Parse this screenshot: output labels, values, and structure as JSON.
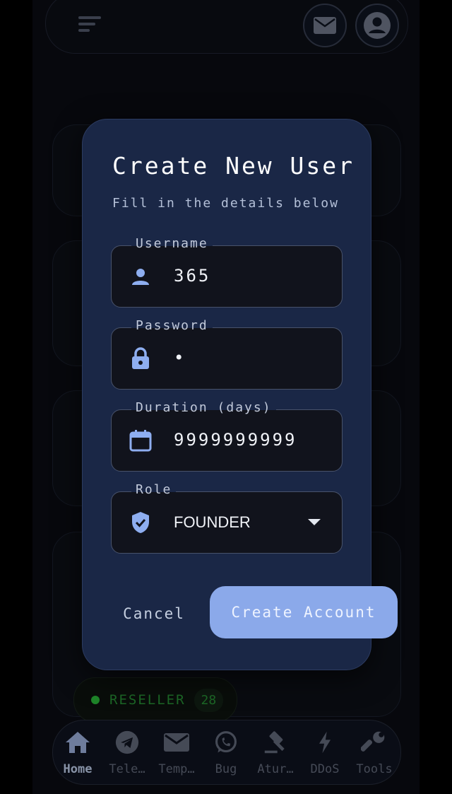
{
  "dialog": {
    "title": "Create New User",
    "subtitle": "Fill in the details below",
    "fields": {
      "username": {
        "label": "Username",
        "value": "365",
        "icon": "user-icon"
      },
      "password": {
        "label": "Password",
        "value": "•",
        "icon": "lock-icon"
      },
      "duration": {
        "label": "Duration (days)",
        "value": "9999999999",
        "icon": "calendar-icon"
      },
      "role": {
        "label": "Role",
        "value": "FOUNDER",
        "icon": "shield-check-icon"
      }
    },
    "cancel_label": "Cancel",
    "create_label": "Create Account"
  },
  "background": {
    "chip": {
      "label": "RESELLER",
      "count": "28"
    }
  },
  "nav": [
    {
      "label": "Home",
      "icon": "home-icon",
      "active": true
    },
    {
      "label": "Tele…",
      "icon": "telegram-icon"
    },
    {
      "label": "Temp…",
      "icon": "mail-icon"
    },
    {
      "label": "Bug",
      "icon": "whatsapp-icon"
    },
    {
      "label": "Atur…",
      "icon": "gavel-icon"
    },
    {
      "label": "DDoS",
      "icon": "bolt-icon"
    },
    {
      "label": "Tools",
      "icon": "wrench-icon"
    }
  ],
  "colors": {
    "dialog_bg": "#1a2746",
    "accent": "#8ba9ea",
    "field_bg": "#11131c",
    "icon_blue": "#8eaef0",
    "chip_green": "#2c9f3b"
  }
}
